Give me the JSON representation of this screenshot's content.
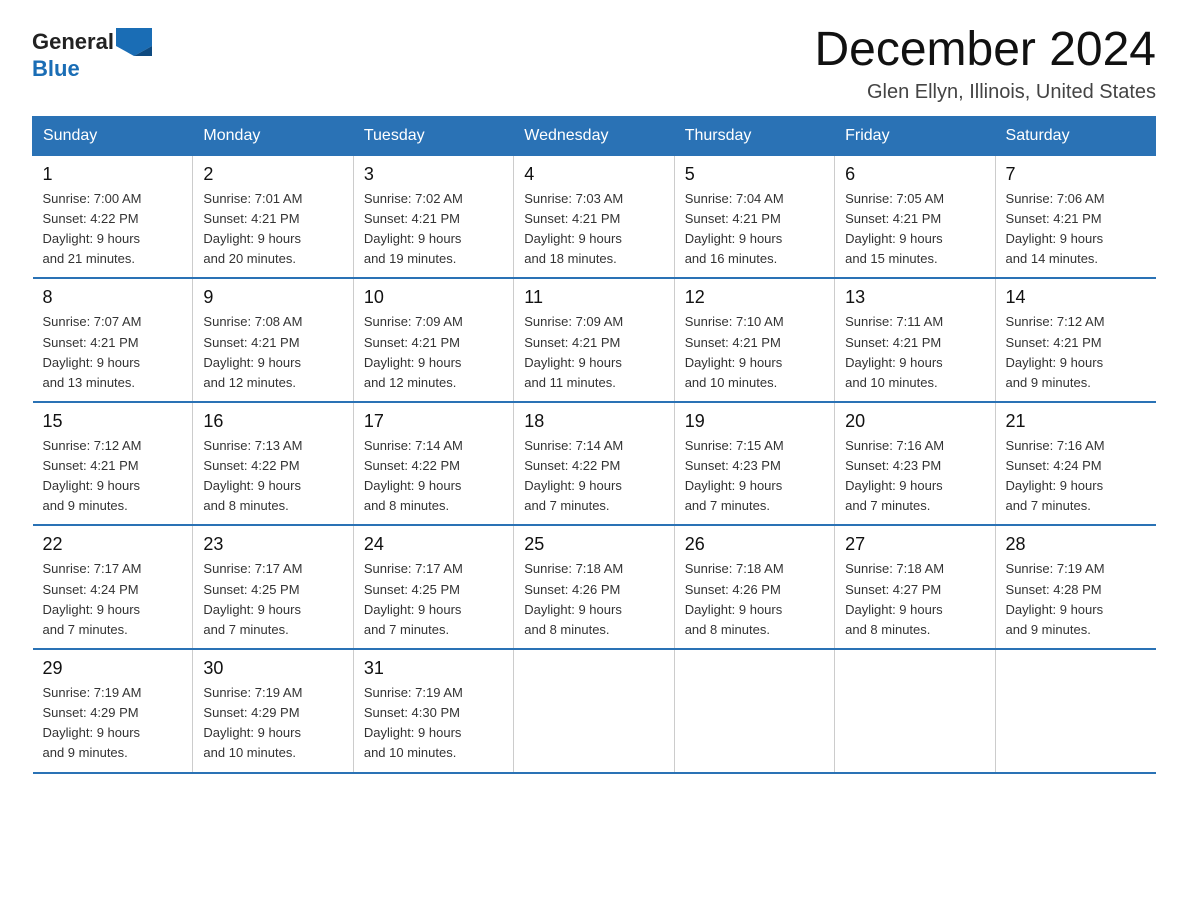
{
  "header": {
    "logo_line1": "General",
    "logo_line2": "Blue",
    "title": "December 2024",
    "subtitle": "Glen Ellyn, Illinois, United States"
  },
  "days_of_week": [
    "Sunday",
    "Monday",
    "Tuesday",
    "Wednesday",
    "Thursday",
    "Friday",
    "Saturday"
  ],
  "weeks": [
    [
      {
        "day": "1",
        "sunrise": "7:00 AM",
        "sunset": "4:22 PM",
        "daylight": "9 hours and 21 minutes."
      },
      {
        "day": "2",
        "sunrise": "7:01 AM",
        "sunset": "4:21 PM",
        "daylight": "9 hours and 20 minutes."
      },
      {
        "day": "3",
        "sunrise": "7:02 AM",
        "sunset": "4:21 PM",
        "daylight": "9 hours and 19 minutes."
      },
      {
        "day": "4",
        "sunrise": "7:03 AM",
        "sunset": "4:21 PM",
        "daylight": "9 hours and 18 minutes."
      },
      {
        "day": "5",
        "sunrise": "7:04 AM",
        "sunset": "4:21 PM",
        "daylight": "9 hours and 16 minutes."
      },
      {
        "day": "6",
        "sunrise": "7:05 AM",
        "sunset": "4:21 PM",
        "daylight": "9 hours and 15 minutes."
      },
      {
        "day": "7",
        "sunrise": "7:06 AM",
        "sunset": "4:21 PM",
        "daylight": "9 hours and 14 minutes."
      }
    ],
    [
      {
        "day": "8",
        "sunrise": "7:07 AM",
        "sunset": "4:21 PM",
        "daylight": "9 hours and 13 minutes."
      },
      {
        "day": "9",
        "sunrise": "7:08 AM",
        "sunset": "4:21 PM",
        "daylight": "9 hours and 12 minutes."
      },
      {
        "day": "10",
        "sunrise": "7:09 AM",
        "sunset": "4:21 PM",
        "daylight": "9 hours and 12 minutes."
      },
      {
        "day": "11",
        "sunrise": "7:09 AM",
        "sunset": "4:21 PM",
        "daylight": "9 hours and 11 minutes."
      },
      {
        "day": "12",
        "sunrise": "7:10 AM",
        "sunset": "4:21 PM",
        "daylight": "9 hours and 10 minutes."
      },
      {
        "day": "13",
        "sunrise": "7:11 AM",
        "sunset": "4:21 PM",
        "daylight": "9 hours and 10 minutes."
      },
      {
        "day": "14",
        "sunrise": "7:12 AM",
        "sunset": "4:21 PM",
        "daylight": "9 hours and 9 minutes."
      }
    ],
    [
      {
        "day": "15",
        "sunrise": "7:12 AM",
        "sunset": "4:21 PM",
        "daylight": "9 hours and 9 minutes."
      },
      {
        "day": "16",
        "sunrise": "7:13 AM",
        "sunset": "4:22 PM",
        "daylight": "9 hours and 8 minutes."
      },
      {
        "day": "17",
        "sunrise": "7:14 AM",
        "sunset": "4:22 PM",
        "daylight": "9 hours and 8 minutes."
      },
      {
        "day": "18",
        "sunrise": "7:14 AM",
        "sunset": "4:22 PM",
        "daylight": "9 hours and 7 minutes."
      },
      {
        "day": "19",
        "sunrise": "7:15 AM",
        "sunset": "4:23 PM",
        "daylight": "9 hours and 7 minutes."
      },
      {
        "day": "20",
        "sunrise": "7:16 AM",
        "sunset": "4:23 PM",
        "daylight": "9 hours and 7 minutes."
      },
      {
        "day": "21",
        "sunrise": "7:16 AM",
        "sunset": "4:24 PM",
        "daylight": "9 hours and 7 minutes."
      }
    ],
    [
      {
        "day": "22",
        "sunrise": "7:17 AM",
        "sunset": "4:24 PM",
        "daylight": "9 hours and 7 minutes."
      },
      {
        "day": "23",
        "sunrise": "7:17 AM",
        "sunset": "4:25 PM",
        "daylight": "9 hours and 7 minutes."
      },
      {
        "day": "24",
        "sunrise": "7:17 AM",
        "sunset": "4:25 PM",
        "daylight": "9 hours and 7 minutes."
      },
      {
        "day": "25",
        "sunrise": "7:18 AM",
        "sunset": "4:26 PM",
        "daylight": "9 hours and 8 minutes."
      },
      {
        "day": "26",
        "sunrise": "7:18 AM",
        "sunset": "4:26 PM",
        "daylight": "9 hours and 8 minutes."
      },
      {
        "day": "27",
        "sunrise": "7:18 AM",
        "sunset": "4:27 PM",
        "daylight": "9 hours and 8 minutes."
      },
      {
        "day": "28",
        "sunrise": "7:19 AM",
        "sunset": "4:28 PM",
        "daylight": "9 hours and 9 minutes."
      }
    ],
    [
      {
        "day": "29",
        "sunrise": "7:19 AM",
        "sunset": "4:29 PM",
        "daylight": "9 hours and 9 minutes."
      },
      {
        "day": "30",
        "sunrise": "7:19 AM",
        "sunset": "4:29 PM",
        "daylight": "9 hours and 10 minutes."
      },
      {
        "day": "31",
        "sunrise": "7:19 AM",
        "sunset": "4:30 PM",
        "daylight": "9 hours and 10 minutes."
      },
      null,
      null,
      null,
      null
    ]
  ]
}
